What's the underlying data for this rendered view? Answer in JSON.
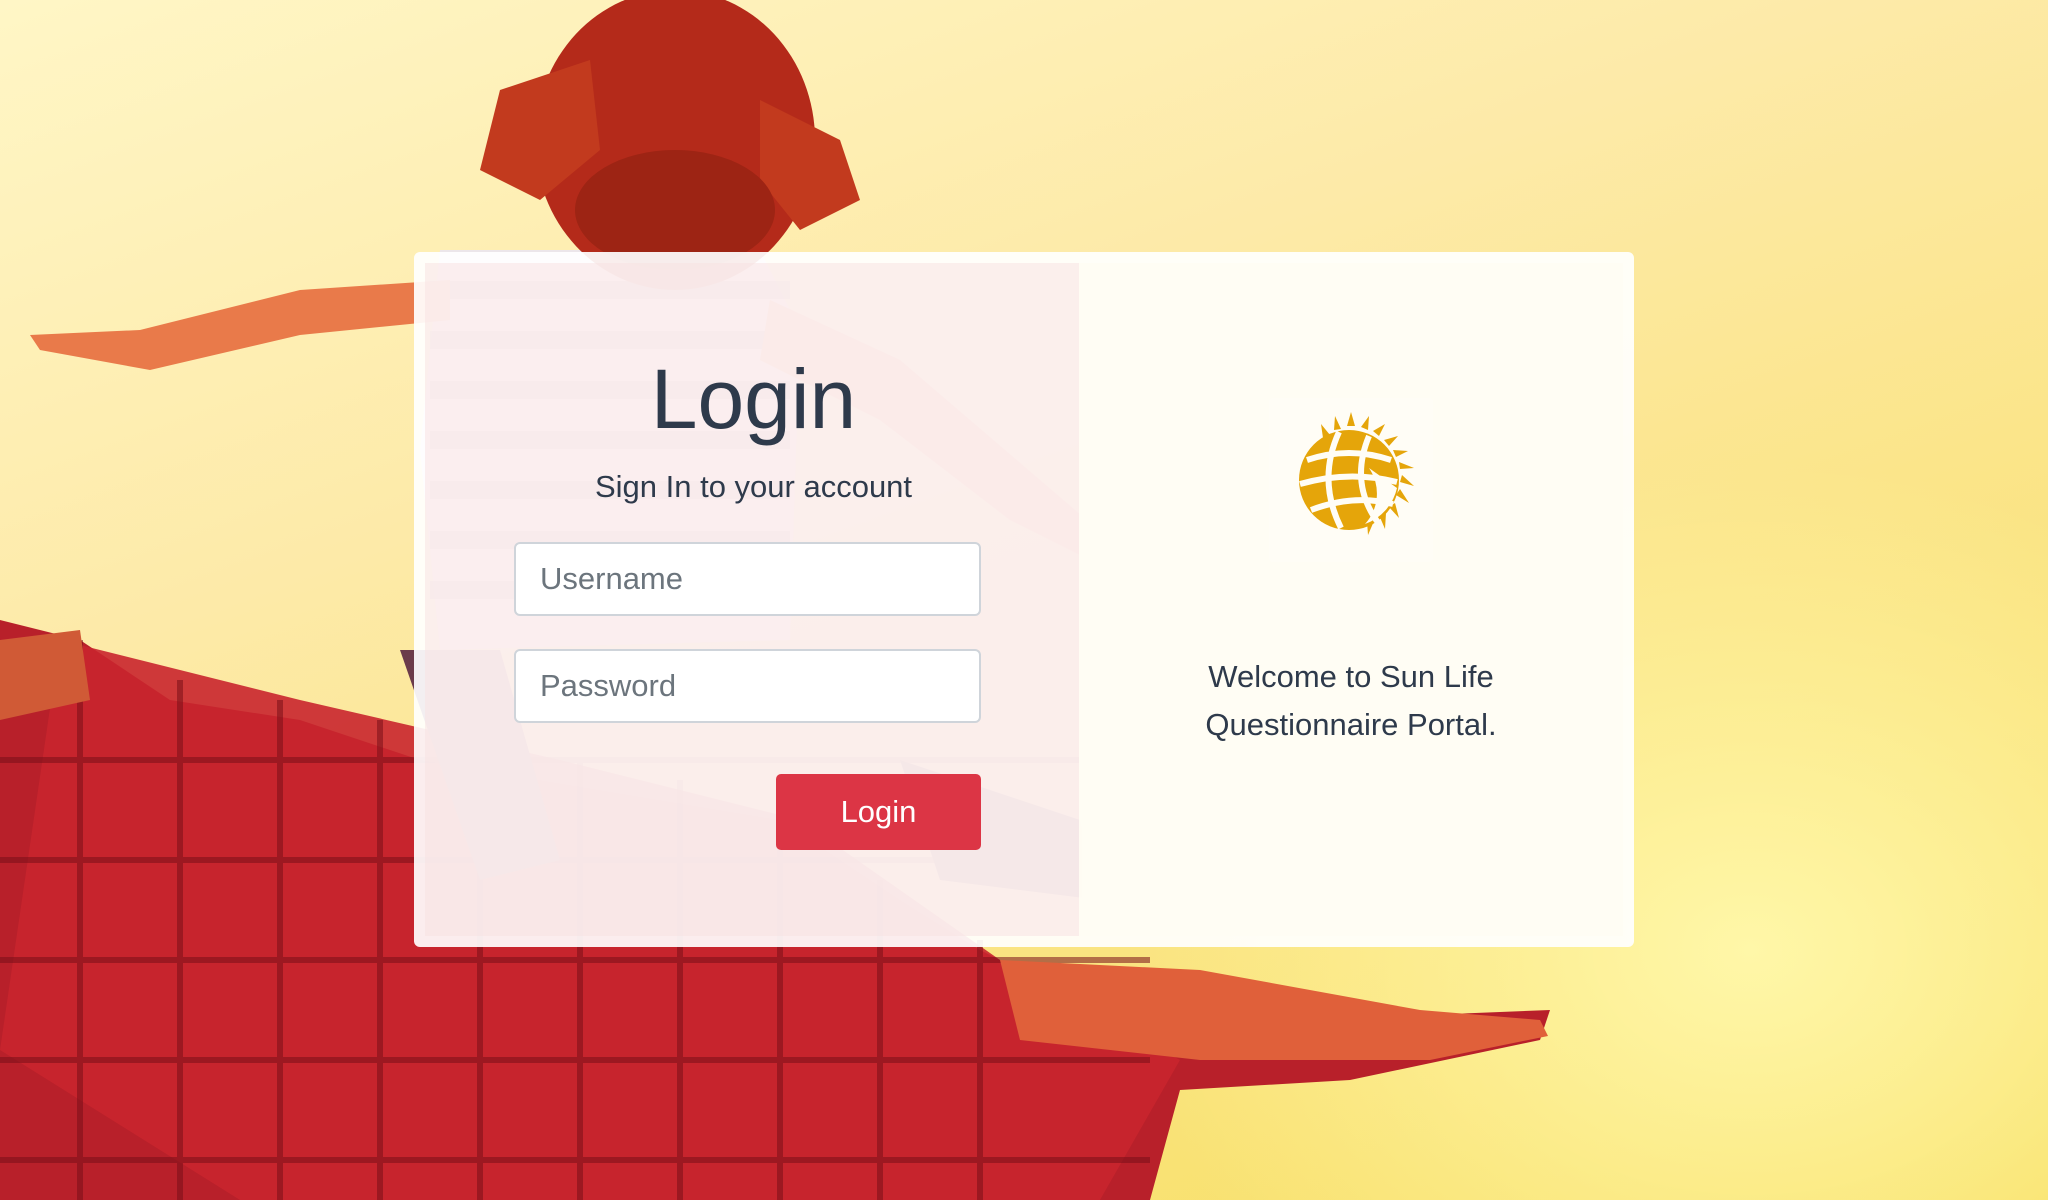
{
  "login": {
    "title": "Login",
    "subtitle": "Sign In to your account",
    "username_placeholder": "Username",
    "password_placeholder": "Password",
    "button_label": "Login"
  },
  "brand": {
    "logo_icon": "sun-life-sun-logo",
    "welcome_line1": "Welcome to Sun Life",
    "welcome_line2": "Questionnaire Portal."
  },
  "colors": {
    "accent": "#dc3545",
    "text": "#2e3a4b",
    "logo": "#e5a50a"
  }
}
